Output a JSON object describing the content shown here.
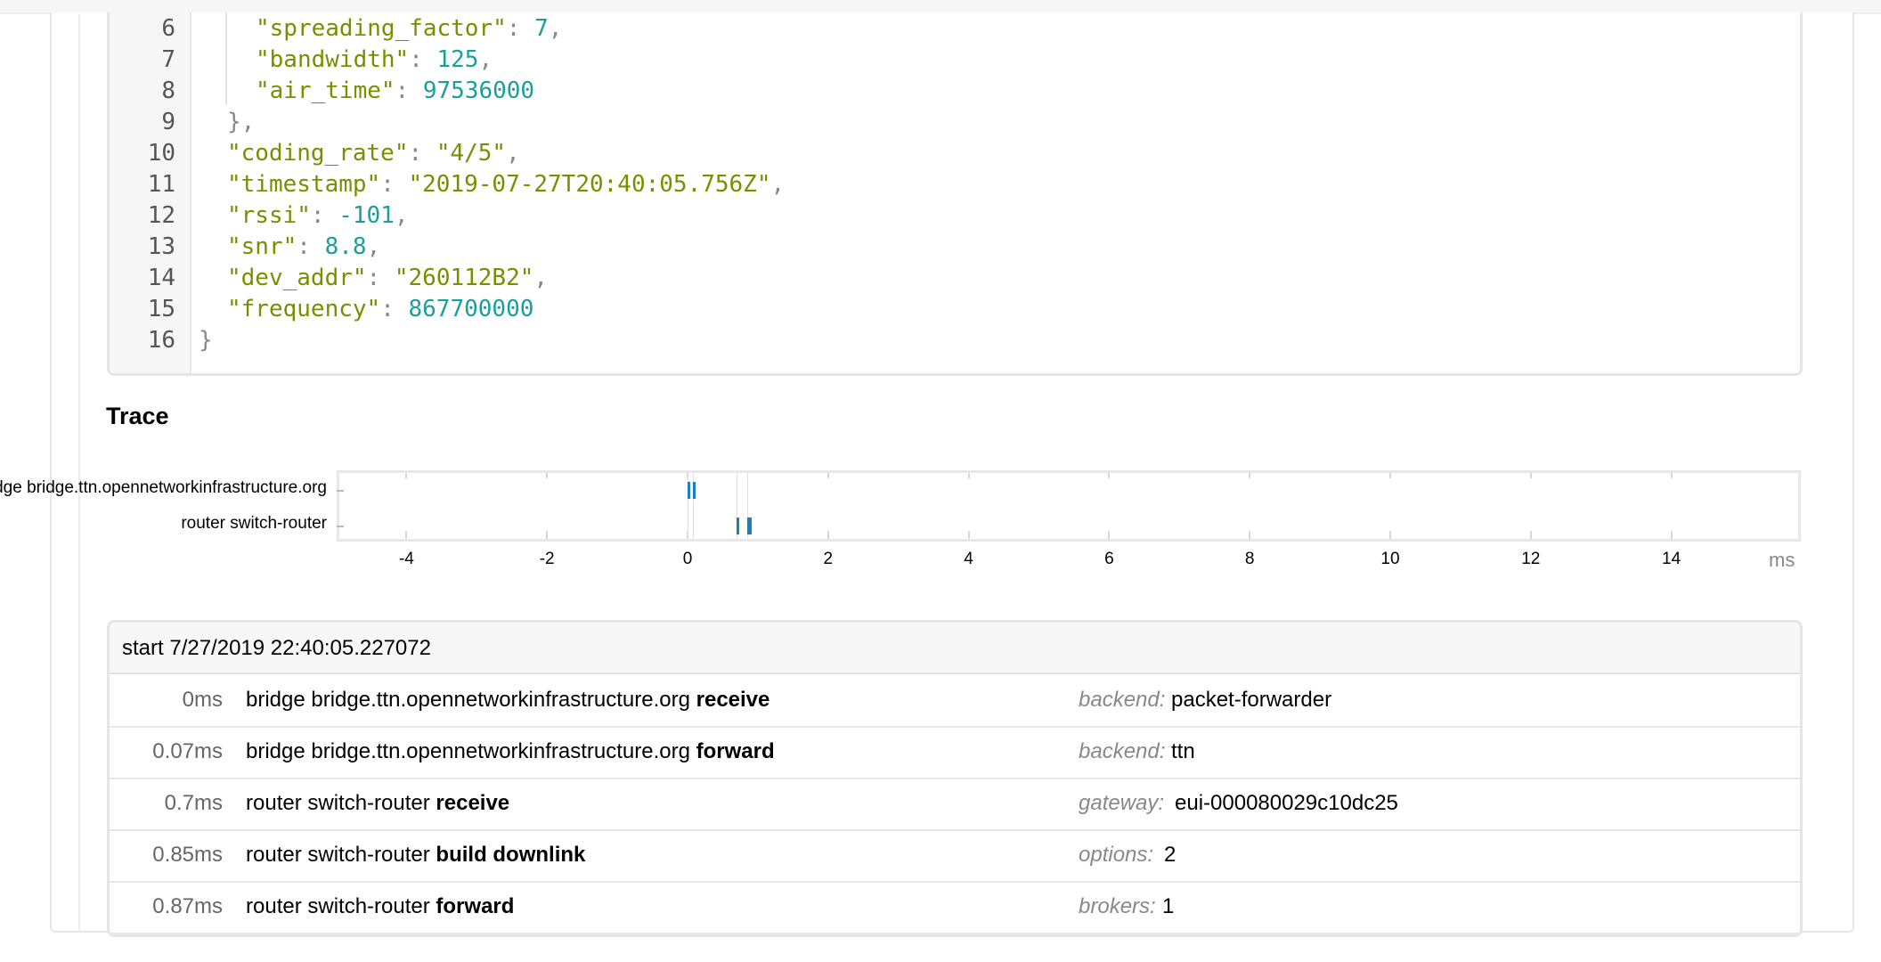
{
  "code": {
    "lines": [
      {
        "n": "6",
        "indent": 2,
        "key": "\"spreading_factor\"",
        "val": "7",
        "vtype": "n",
        "comma": true
      },
      {
        "n": "7",
        "indent": 2,
        "key": "\"bandwidth\"",
        "val": "125",
        "vtype": "n",
        "comma": true
      },
      {
        "n": "8",
        "indent": 2,
        "key": "\"air_time\"",
        "val": "97536000",
        "vtype": "n",
        "comma": false
      },
      {
        "n": "9",
        "indent": 1,
        "raw": "},"
      },
      {
        "n": "10",
        "indent": 1,
        "key": "\"coding_rate\"",
        "val": "\"4/5\"",
        "vtype": "s",
        "comma": true
      },
      {
        "n": "11",
        "indent": 1,
        "key": "\"timestamp\"",
        "val": "\"2019-07-27T20:40:05.756Z\"",
        "vtype": "s",
        "comma": true
      },
      {
        "n": "12",
        "indent": 1,
        "key": "\"rssi\"",
        "val": "-101",
        "vtype": "n",
        "comma": true
      },
      {
        "n": "13",
        "indent": 1,
        "key": "\"snr\"",
        "val": "8.8",
        "vtype": "n",
        "comma": true
      },
      {
        "n": "14",
        "indent": 1,
        "key": "\"dev_addr\"",
        "val": "\"260112B2\"",
        "vtype": "s",
        "comma": true
      },
      {
        "n": "15",
        "indent": 1,
        "key": "\"frequency\"",
        "val": "867700000",
        "vtype": "n",
        "comma": false
      },
      {
        "n": "16",
        "indent": 0,
        "raw": "}"
      }
    ]
  },
  "trace": {
    "title": "Trace",
    "lanes": [
      {
        "label": "bridge bridge.ttn.opennetworkinfrastructure.org",
        "marks": [
          0,
          0.07
        ]
      },
      {
        "label": "router switch-router",
        "marks": [
          0.7,
          0.85,
          0.87
        ]
      }
    ],
    "axis": {
      "min": -5,
      "max": 16,
      "ticks": [
        -4,
        -2,
        0,
        2,
        4,
        6,
        8,
        10,
        12,
        14
      ],
      "unit": "ms"
    },
    "mark_color": "#1a7fc4"
  },
  "events": {
    "start_label": "start 7/27/2019 22:40:05.227072",
    "rows": [
      {
        "time": "0ms",
        "actor": "bridge bridge.ttn.opennetworkinfrastructure.org",
        "event": "receive",
        "key": "backend:",
        "value": "packet-forwarder"
      },
      {
        "time": "0.07ms",
        "actor": "bridge bridge.ttn.opennetworkinfrastructure.org",
        "event": "forward",
        "key": "backend:",
        "value": "ttn"
      },
      {
        "time": "0.7ms",
        "actor": "router switch-router",
        "event": "receive",
        "key": "gateway:",
        "value": "eui-000080029c10dc25"
      },
      {
        "time": "0.85ms",
        "actor": "router switch-router",
        "event": "build downlink",
        "key": "options:",
        "value": "2"
      },
      {
        "time": "0.87ms",
        "actor": "router switch-router",
        "event": "forward",
        "key": "brokers:",
        "value": "1"
      }
    ]
  }
}
